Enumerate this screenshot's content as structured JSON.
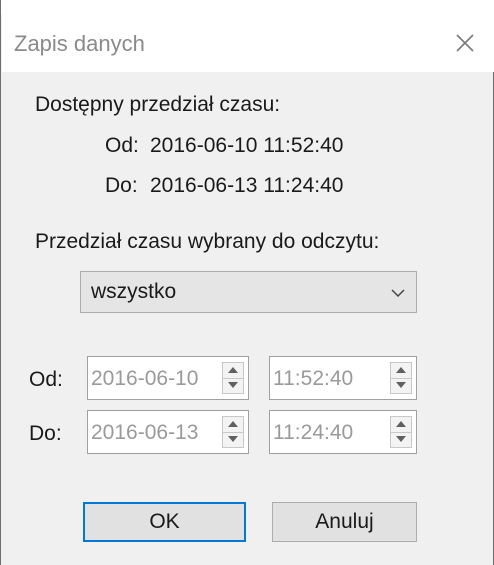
{
  "dialog": {
    "title": "Zapis danych"
  },
  "available": {
    "heading": "Dostępny przedział czasu:",
    "from_label": "Od:",
    "from_value": "2016-06-10 11:52:40",
    "to_label": "Do:",
    "to_value": "2016-06-13 11:24:40"
  },
  "selected": {
    "heading": "Przedział czasu wybrany do odczytu:",
    "range_option": "wszystko",
    "from_label": "Od:",
    "from_date": "2016-06-10",
    "from_time": "11:52:40",
    "to_label": "Do:",
    "to_date": "2016-06-13",
    "to_time": "11:24:40"
  },
  "buttons": {
    "ok": "OK",
    "cancel": "Anuluj"
  },
  "colors": {
    "accent": "#0078d7",
    "dialog_bg": "#f0f0f0",
    "title_text": "#8a8a8a"
  }
}
